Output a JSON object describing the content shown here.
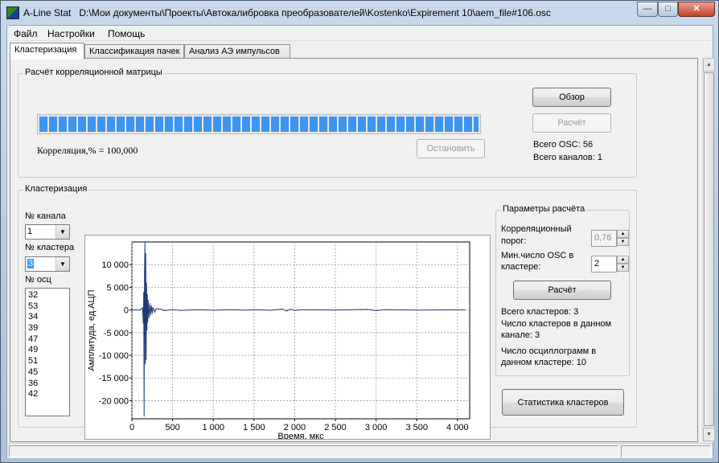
{
  "window": {
    "app_name": "A-Line Stat",
    "file_path": "D:\\Мои документы\\Проекты\\Автокалибровка преобразователей\\Kostenko\\Expirement 10\\aem_file#106.osc",
    "min_glyph": "—",
    "max_glyph": "□",
    "close_glyph": "✕"
  },
  "menu": [
    "Файл",
    "Настройки",
    "Помощь"
  ],
  "tabs": [
    "Кластеризация",
    "Классификация пачек",
    "Анализ АЭ импульсов"
  ],
  "correlation_group": {
    "title": "Расчёт корреляционной матрицы",
    "progress": 1.0,
    "correlation_text": "Корреляция,% = 100,000",
    "stop_label": "Остановить",
    "browse_label": "Обзор",
    "calc_label": "Расчёт",
    "total_osc": "Всего OSC: 56",
    "total_channels": "Всего каналов: 1"
  },
  "clustering_group": {
    "title": "Кластеризация",
    "channel_label": "№ канала",
    "channel_value": "1",
    "cluster_label": "№ кластера",
    "cluster_value": "3",
    "osc_label": "№ осц",
    "osc_list": [
      "32",
      "53",
      "34",
      "39",
      "47",
      "49",
      "51",
      "45",
      "36",
      "42"
    ]
  },
  "params_group": {
    "title": "Параметры расчёта",
    "corr_threshold_label_1": "Корреляционный",
    "corr_threshold_label_2": "порог:",
    "corr_threshold_value": "0,76",
    "min_osc_label_1": "Мин.число OSC в",
    "min_osc_label_2": "кластере:",
    "min_osc_value": "2",
    "calc_label": "Расчёт",
    "total_clusters": "Всего кластеров: 3",
    "clusters_in_channel_1": "Число кластеров в данном",
    "clusters_in_channel_2": "канале: 3",
    "osc_in_cluster_1": "Число осциллограмм в",
    "osc_in_cluster_2": "данном кластере: 10"
  },
  "stats_button_label": "Статистика кластеров",
  "icons": {
    "spin_up": "▲",
    "spin_down": "▼",
    "dropdown": "▼",
    "scroll_up": "▲",
    "scroll_down": "▼"
  },
  "chart_data": {
    "type": "line",
    "xlabel": "Время, мкс",
    "ylabel": "Амплитуда, ед.АЦП",
    "xlim": [
      0,
      4150
    ],
    "ylim": [
      -24000,
      15000
    ],
    "x_ticks": [
      0,
      500,
      1000,
      1500,
      2000,
      2500,
      3000,
      3500,
      4000
    ],
    "x_tick_labels": [
      "0",
      "500",
      "1 000",
      "1 500",
      "2 000",
      "2 500",
      "3 000",
      "3 500",
      "4 000"
    ],
    "y_ticks": [
      10000,
      5000,
      0,
      -5000,
      -10000,
      -15000,
      -20000
    ],
    "y_tick_labels": [
      "10 000",
      "5 000",
      "0",
      "-5 000",
      "-10 000",
      "-15 000",
      "-20 000"
    ],
    "grid": true,
    "color": "#1f3b73",
    "series": [
      {
        "x": [
          0,
          100,
          130,
          140,
          145,
          150,
          155,
          160,
          165,
          170,
          175,
          180,
          185,
          190,
          195,
          200,
          210,
          220,
          230,
          240,
          250,
          260,
          280,
          300,
          350,
          400,
          500,
          600,
          800,
          1000,
          1200,
          1400,
          1500,
          1700,
          1850,
          1900,
          1950,
          2000,
          2100,
          2500,
          2900,
          3000,
          3100,
          3500,
          4000,
          4100
        ],
        "y": [
          0,
          0,
          500,
          -3000,
          4000,
          -23500,
          8000,
          15000,
          -12000,
          12500,
          -11000,
          6000,
          -4500,
          3500,
          -2800,
          2200,
          -1800,
          1500,
          -1200,
          1000,
          -800,
          600,
          -500,
          300,
          200,
          -150,
          100,
          -100,
          80,
          -60,
          50,
          -50,
          60,
          -60,
          200,
          -250,
          180,
          -100,
          60,
          -40,
          120,
          -150,
          60,
          -30,
          20,
          0
        ]
      }
    ]
  }
}
